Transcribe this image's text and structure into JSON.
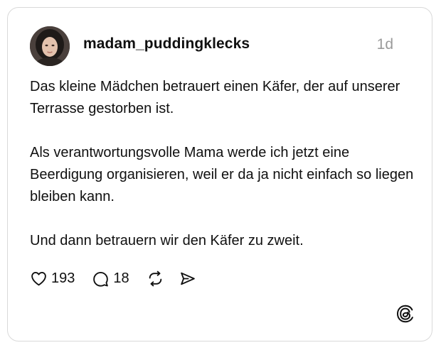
{
  "post": {
    "username": "madam_puddingklecks",
    "time": "1d",
    "paragraphs": [
      "Das kleine Mädchen betrauert einen Käfer, der auf unserer Terrasse gestorben ist.",
      "Als verantwortungsvolle Mama werde ich jetzt eine Beerdigung organisieren, weil er da ja nicht einfach so liegen bleiben kann.",
      "Und dann betrauern wir den Käfer zu zweit."
    ]
  },
  "actions": {
    "likes": "193",
    "replies": "18"
  },
  "icons": {
    "like": "heart-icon",
    "reply": "speech-bubble-icon",
    "repost": "repost-icon",
    "share": "send-icon",
    "brand": "threads-logo-icon"
  },
  "colors": {
    "text": "#101010",
    "muted": "#9a9a9a",
    "border": "#d9d9d9"
  }
}
